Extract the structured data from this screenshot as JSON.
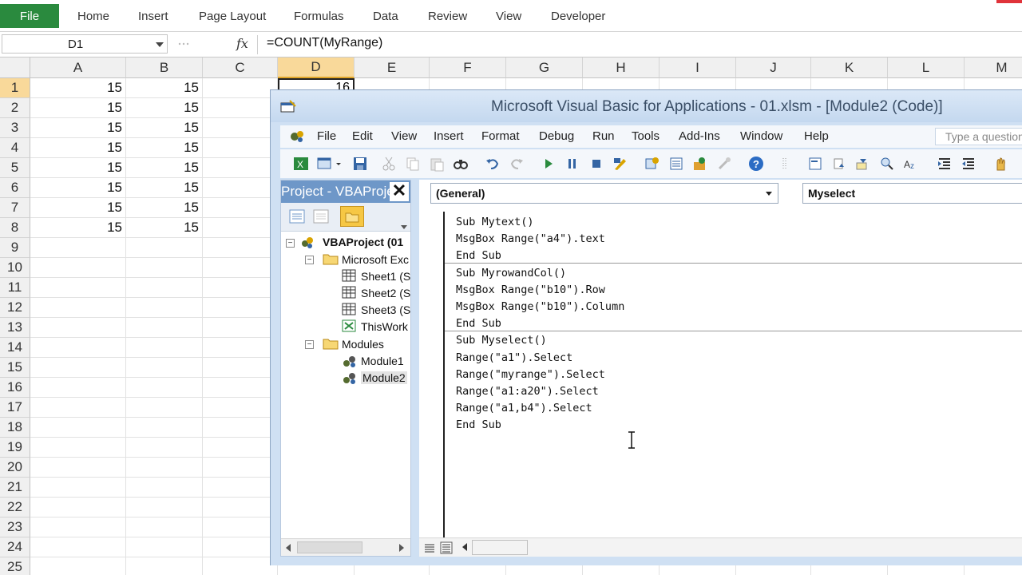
{
  "excel": {
    "file_tab": "File",
    "tabs": [
      "Home",
      "Insert",
      "Page Layout",
      "Formulas",
      "Data",
      "Review",
      "View",
      "Developer"
    ],
    "name_box": "D1",
    "fx_label": "fx",
    "formula": "=COUNT(MyRange)",
    "columns": [
      "A",
      "B",
      "C",
      "D",
      "E",
      "F",
      "G",
      "H",
      "I",
      "J",
      "K",
      "L",
      "M"
    ],
    "rows": [
      "1",
      "2",
      "3",
      "4",
      "5",
      "6",
      "7",
      "8",
      "9",
      "10",
      "11",
      "12",
      "13",
      "14",
      "15",
      "16",
      "17",
      "18",
      "19",
      "20",
      "21",
      "22",
      "23",
      "24",
      "25"
    ],
    "col_a_values": [
      "15",
      "15",
      "15",
      "15",
      "15",
      "15",
      "15",
      "15"
    ],
    "col_b_values": [
      "15",
      "15",
      "15",
      "15",
      "15",
      "15",
      "15",
      "15"
    ],
    "d1_value": "16",
    "selected_cell": "D1"
  },
  "vbe": {
    "title": "Microsoft Visual Basic for Applications - 01.xlsm - [Module2 (Code)]",
    "menu": [
      "File",
      "Edit",
      "View",
      "Insert",
      "Format",
      "Debug",
      "Run",
      "Tools",
      "Add-Ins",
      "Window",
      "Help"
    ],
    "ask_placeholder": "Type a question",
    "project": {
      "header": "Project - VBAProject",
      "root": "VBAProject (01",
      "excel_objects": "Microsoft Exc",
      "sheets": [
        "Sheet1 (S",
        "Sheet2 (S",
        "Sheet3 (S",
        "ThisWork"
      ],
      "modules_folder": "Modules",
      "modules": [
        "Module1",
        "Module2"
      ]
    },
    "object_combo": "(General)",
    "proc_combo": "Myselect",
    "code_lines": [
      "Sub Mytext()",
      "MsgBox Range(\"a4\").text",
      "End Sub",
      "Sub MyrowandCol()",
      "MsgBox Range(\"b10\").Row",
      "MsgBox Range(\"b10\").Column",
      "End Sub",
      "Sub Myselect()",
      "Range(\"a1\").Select",
      "Range(\"myrange\").Select",
      "Range(\"a1:a20\").Select",
      "Range(\"a1,b4\").Select",
      "End Sub"
    ]
  },
  "colors": {
    "excel_green": "#2a8a3e",
    "selection_header": "#f9d99a",
    "vbe_frame": "#cfe0f3",
    "project_header": "#6e97c8"
  }
}
